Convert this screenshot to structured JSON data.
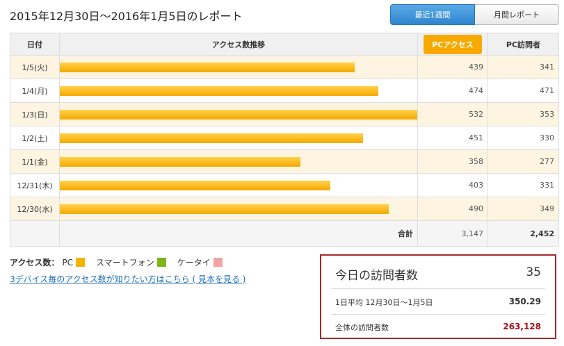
{
  "title": "2015年12月30日〜2016年1月5日のレポート",
  "tabs": {
    "week": "最近1週間",
    "month": "月間レポート"
  },
  "table": {
    "headers": {
      "date": "日付",
      "trend": "アクセス数推移",
      "pc": "PCアクセス",
      "visitors": "PC訪問者"
    },
    "max_access": 532,
    "rows": [
      {
        "date": "1/5(火)",
        "pc": "439",
        "visitors": "341",
        "value": 439
      },
      {
        "date": "1/4(月)",
        "pc": "474",
        "visitors": "471",
        "value": 474
      },
      {
        "date": "1/3(日)",
        "pc": "532",
        "visitors": "353",
        "value": 532
      },
      {
        "date": "1/2(土)",
        "pc": "451",
        "visitors": "330",
        "value": 451
      },
      {
        "date": "1/1(金)",
        "pc": "358",
        "visitors": "277",
        "value": 358
      },
      {
        "date": "12/31(木)",
        "pc": "403",
        "visitors": "331",
        "value": 403
      },
      {
        "date": "12/30(水)",
        "pc": "490",
        "visitors": "349",
        "value": 490
      }
    ],
    "total": {
      "label": "合計",
      "pc": "3,147",
      "visitors": "2,452"
    }
  },
  "legend": {
    "label": "アクセス数：",
    "items": [
      {
        "name": "PC",
        "color": "#f5b400"
      },
      {
        "name": "スマートフォン",
        "color": "#7cb518"
      },
      {
        "name": "ケータイ",
        "color": "#f4a3a3"
      }
    ]
  },
  "link_text": "3デバイス毎のアクセス数が知りたい方はこちら ( 見本を見る )",
  "summary": {
    "today_label": "今日の訪問者数",
    "today_value": "35",
    "avg_label": "1日平均 12月30日〜1月5日",
    "avg_value": "350.29",
    "all_label": "全体の訪問者数",
    "all_value": "263,128"
  }
}
